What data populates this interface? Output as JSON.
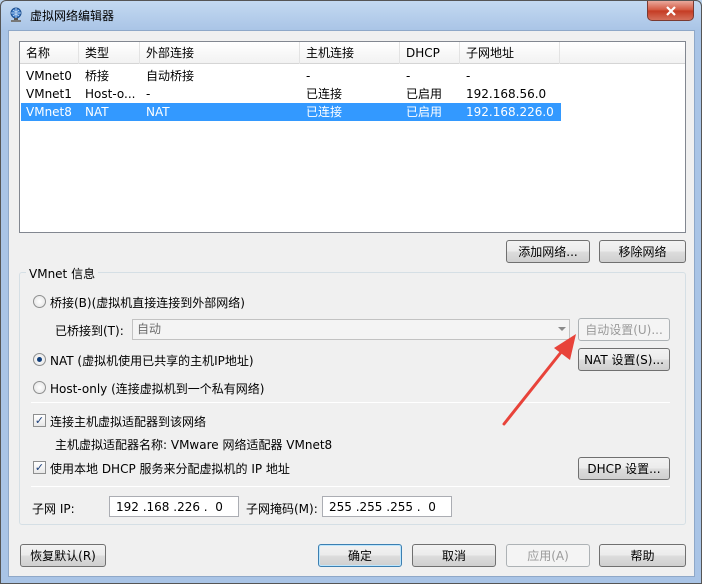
{
  "window": {
    "title": "虚拟网络编辑器",
    "close_label": "✕"
  },
  "network_table": {
    "columns": [
      "名称",
      "类型",
      "外部连接",
      "主机连接",
      "DHCP",
      "子网地址"
    ],
    "rows": [
      {
        "name": "VMnet0",
        "type": "桥接",
        "external": "自动桥接",
        "host": "-",
        "dhcp": "-",
        "subnet": "-"
      },
      {
        "name": "VMnet1",
        "type": "Host-o...",
        "external": "-",
        "host": "已连接",
        "dhcp": "已启用",
        "subnet": "192.168.56.0"
      },
      {
        "name": "VMnet8",
        "type": "NAT",
        "external": "NAT",
        "host": "已连接",
        "dhcp": "已启用",
        "subnet": "192.168.226.0"
      }
    ],
    "selected_row": 2
  },
  "table_buttons": {
    "add": "添加网络...",
    "remove": "移除网络"
  },
  "vmnet_info": {
    "group_label": "VMnet 信息",
    "bridge_radio": "桥接(B)(虚拟机直接连接到外部网络)",
    "bridged_to_label": "已桥接到(T):",
    "bridged_to_value": "自动",
    "auto_settings": "自动设置(U)...",
    "nat_radio": "NAT (虚拟机使用已共享的主机IP地址)",
    "nat_settings": "NAT 设置(S)...",
    "hostonly_radio": "Host-only (连接虚拟机到一个私有网络)",
    "selected_mode": "nat",
    "connect_adapter_check": "连接主机虚拟适配器到该网络",
    "connect_adapter_checked": true,
    "adapter_name": "主机虚拟适配器名称: VMware 网络适配器 VMnet8",
    "dhcp_check": "使用本地 DHCP 服务来分配虚拟机的 IP 地址",
    "dhcp_checked": true,
    "dhcp_settings": "DHCP 设置...",
    "subnet_ip_label": "子网 IP:",
    "subnet_ip": "192 .168 .226 .  0",
    "subnet_mask_label": "子网掩码(M):",
    "subnet_mask": "255 .255 .255 .  0"
  },
  "footer": {
    "restore": "恢复默认(R)",
    "ok": "确定",
    "cancel": "取消",
    "apply": "应用(A)",
    "help": "帮助"
  },
  "colors": {
    "selection": "#3399ff",
    "annotation_arrow": "#e8433a"
  }
}
